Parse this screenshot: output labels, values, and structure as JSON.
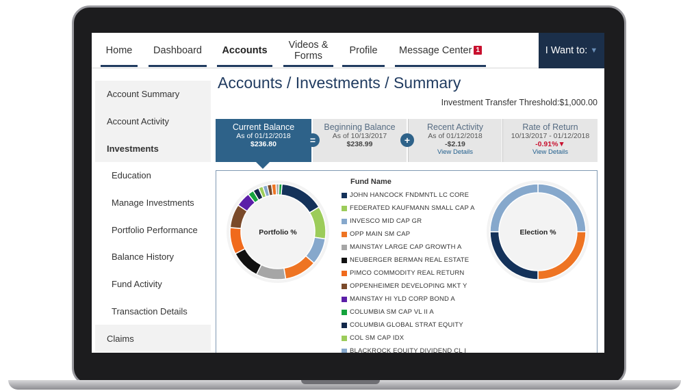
{
  "nav": {
    "items": [
      {
        "label": "Home"
      },
      {
        "label": "Dashboard"
      },
      {
        "label": "Accounts"
      },
      {
        "label_line1": "Videos &",
        "label_line2": "Forms"
      },
      {
        "label": "Profile"
      },
      {
        "label": "Message Center",
        "badge": "1"
      }
    ],
    "iwant_label": "I Want to:"
  },
  "sidebar": {
    "items": [
      {
        "label": "Account Summary"
      },
      {
        "label": "Account Activity"
      },
      {
        "label": "Investments"
      },
      {
        "label": "Education"
      },
      {
        "label": "Manage Investments"
      },
      {
        "label": "Portfolio Performance"
      },
      {
        "label": "Balance History"
      },
      {
        "label": "Fund Activity"
      },
      {
        "label": "Transaction Details"
      },
      {
        "label": "Claims"
      }
    ]
  },
  "page": {
    "title": "Accounts / Investments / Summary",
    "threshold": "Investment Transfer Threshold:$1,000.00"
  },
  "summary": {
    "current": {
      "label": "Current Balance",
      "date": "As of 01/12/2018",
      "value": "$236.80"
    },
    "beginning": {
      "label": "Beginning Balance",
      "date": "As of 10/13/2017",
      "value": "$238.99"
    },
    "activity": {
      "label": "Recent Activity",
      "date": "As of 01/12/2018",
      "value": "-$2.19",
      "link": "View Details"
    },
    "return": {
      "label": "Rate of Return",
      "date": "10/13/2017 - 01/12/2018",
      "value": "-0.91%▼",
      "link": "View Details"
    },
    "op_equals": "=",
    "op_plus": "+"
  },
  "funds": {
    "title": "Fund Name",
    "items": [
      {
        "name": "JOHN HANCOCK FNDMNTL LC CORE",
        "color": "#14325a"
      },
      {
        "name": "FEDERATED KAUFMANN SMALL CAP A",
        "color": "#9ccc5a"
      },
      {
        "name": "INVESCO MID CAP GR",
        "color": "#86a8cc"
      },
      {
        "name": "OPP MAIN SM CAP",
        "color": "#ee7423"
      },
      {
        "name": "MAINSTAY LARGE CAP GROWTH A",
        "color": "#a6a6a6"
      },
      {
        "name": "NEUBERGER BERMAN REAL ESTATE",
        "color": "#111111"
      },
      {
        "name": "PIMCO COMMODITY REAL RETURN",
        "color": "#f06a1c"
      },
      {
        "name": "OPPENHEIMER DEVELOPING MKT Y",
        "color": "#7a4a2a"
      },
      {
        "name": "MAINSTAY HI YLD CORP BOND A",
        "color": "#5b1fa8"
      },
      {
        "name": "COLUMBIA SM CAP VL II A",
        "color": "#14a33c"
      },
      {
        "name": "COLUMBIA GLOBAL STRAT EQUITY",
        "color": "#12284a"
      },
      {
        "name": "COL SM CAP IDX",
        "color": "#9ccc5a"
      },
      {
        "name": "BLACKROCK EQUITY DIVIDEND CL I",
        "color": "#86a8cc"
      }
    ]
  },
  "chart_data": [
    {
      "type": "pie",
      "title": "Portfolio %",
      "slices": [
        {
          "label": "JOHN HANCOCK FNDMNTL LC CORE",
          "value": 15,
          "color": "#14325a"
        },
        {
          "label": "FEDERATED KAUFMANN SMALL CAP A",
          "value": 11,
          "color": "#9ccc5a"
        },
        {
          "label": "INVESCO MID CAP GR",
          "value": 9,
          "color": "#86a8cc"
        },
        {
          "label": "OPP MAIN SM CAP",
          "value": 11,
          "color": "#ee7423"
        },
        {
          "label": "MAINSTAY LARGE CAP GROWTH A",
          "value": 10,
          "color": "#a6a6a6"
        },
        {
          "label": "NEUBERGER BERMAN REAL ESTATE",
          "value": 10,
          "color": "#111111"
        },
        {
          "label": "PIMCO COMMODITY REAL RETURN",
          "value": 9,
          "color": "#f06a1c"
        },
        {
          "label": "OPPENHEIMER DEVELOPING MKT Y",
          "value": 8,
          "color": "#7a4a2a"
        },
        {
          "label": "MAINSTAY HI YLD CORP BOND A",
          "value": 5,
          "color": "#5b1fa8"
        },
        {
          "label": "COLUMBIA SM CAP VL II A",
          "value": 2,
          "color": "#14a33c"
        },
        {
          "label": "COLUMBIA GLOBAL STRAT EQUITY",
          "value": 2,
          "color": "#12284a"
        },
        {
          "label": "COL SM CAP IDX",
          "value": 1.5,
          "color": "#9ccc5a"
        },
        {
          "label": "BLACKROCK EQUITY DIVIDEND CL I",
          "value": 1.5,
          "color": "#86a8cc"
        },
        {
          "label": "",
          "value": 1.5,
          "color": "#7a4a2a"
        },
        {
          "label": "",
          "value": 1.5,
          "color": "#ee7423"
        },
        {
          "label": "",
          "value": 1,
          "color": "#a6a6a6"
        },
        {
          "label": "",
          "value": 1,
          "color": "#14a33c"
        }
      ]
    },
    {
      "type": "pie",
      "title": "Election %",
      "slices": [
        {
          "label": "",
          "value": 25,
          "color": "#86a8cc"
        },
        {
          "label": "",
          "value": 25,
          "color": "#ee7423"
        },
        {
          "label": "",
          "value": 25,
          "color": "#14325a"
        },
        {
          "label": "",
          "value": 25,
          "color": "#86a8cc"
        }
      ]
    }
  ]
}
